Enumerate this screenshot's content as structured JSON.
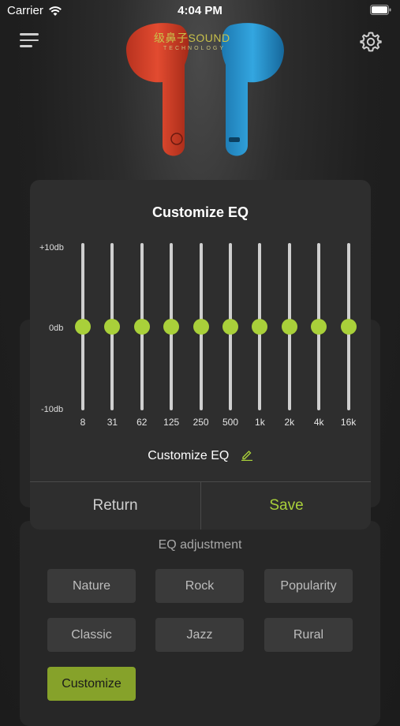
{
  "status_bar": {
    "carrier": "Carrier",
    "time": "4:04 PM"
  },
  "brand": {
    "name": "级鼻子SOUND",
    "tagline": "TECHNOLOGY"
  },
  "modal": {
    "title": "Customize EQ",
    "db_labels": {
      "top": "+10db",
      "mid": "0db",
      "bottom": "-10db"
    },
    "bands": [
      {
        "freq": "8",
        "gain_db": 0
      },
      {
        "freq": "31",
        "gain_db": 0
      },
      {
        "freq": "62",
        "gain_db": 0
      },
      {
        "freq": "125",
        "gain_db": 0
      },
      {
        "freq": "250",
        "gain_db": 0
      },
      {
        "freq": "500",
        "gain_db": 0
      },
      {
        "freq": "1k",
        "gain_db": 0
      },
      {
        "freq": "2k",
        "gain_db": 0
      },
      {
        "freq": "4k",
        "gain_db": 0
      },
      {
        "freq": "16k",
        "gain_db": 0
      }
    ],
    "preset_name": "Customize EQ",
    "return_label": "Return",
    "save_label": "Save"
  },
  "eq_adjustment": {
    "title": "EQ adjustment",
    "presets": [
      "Nature",
      "Rock",
      "Popularity",
      "Classic",
      "Jazz",
      "Rural",
      "Customize"
    ],
    "selected": "Customize"
  },
  "colors": {
    "accent": "#a9d03a",
    "active_preset": "#86a22a",
    "left_bud": "#d8422a",
    "right_bud": "#2a9bd8"
  }
}
